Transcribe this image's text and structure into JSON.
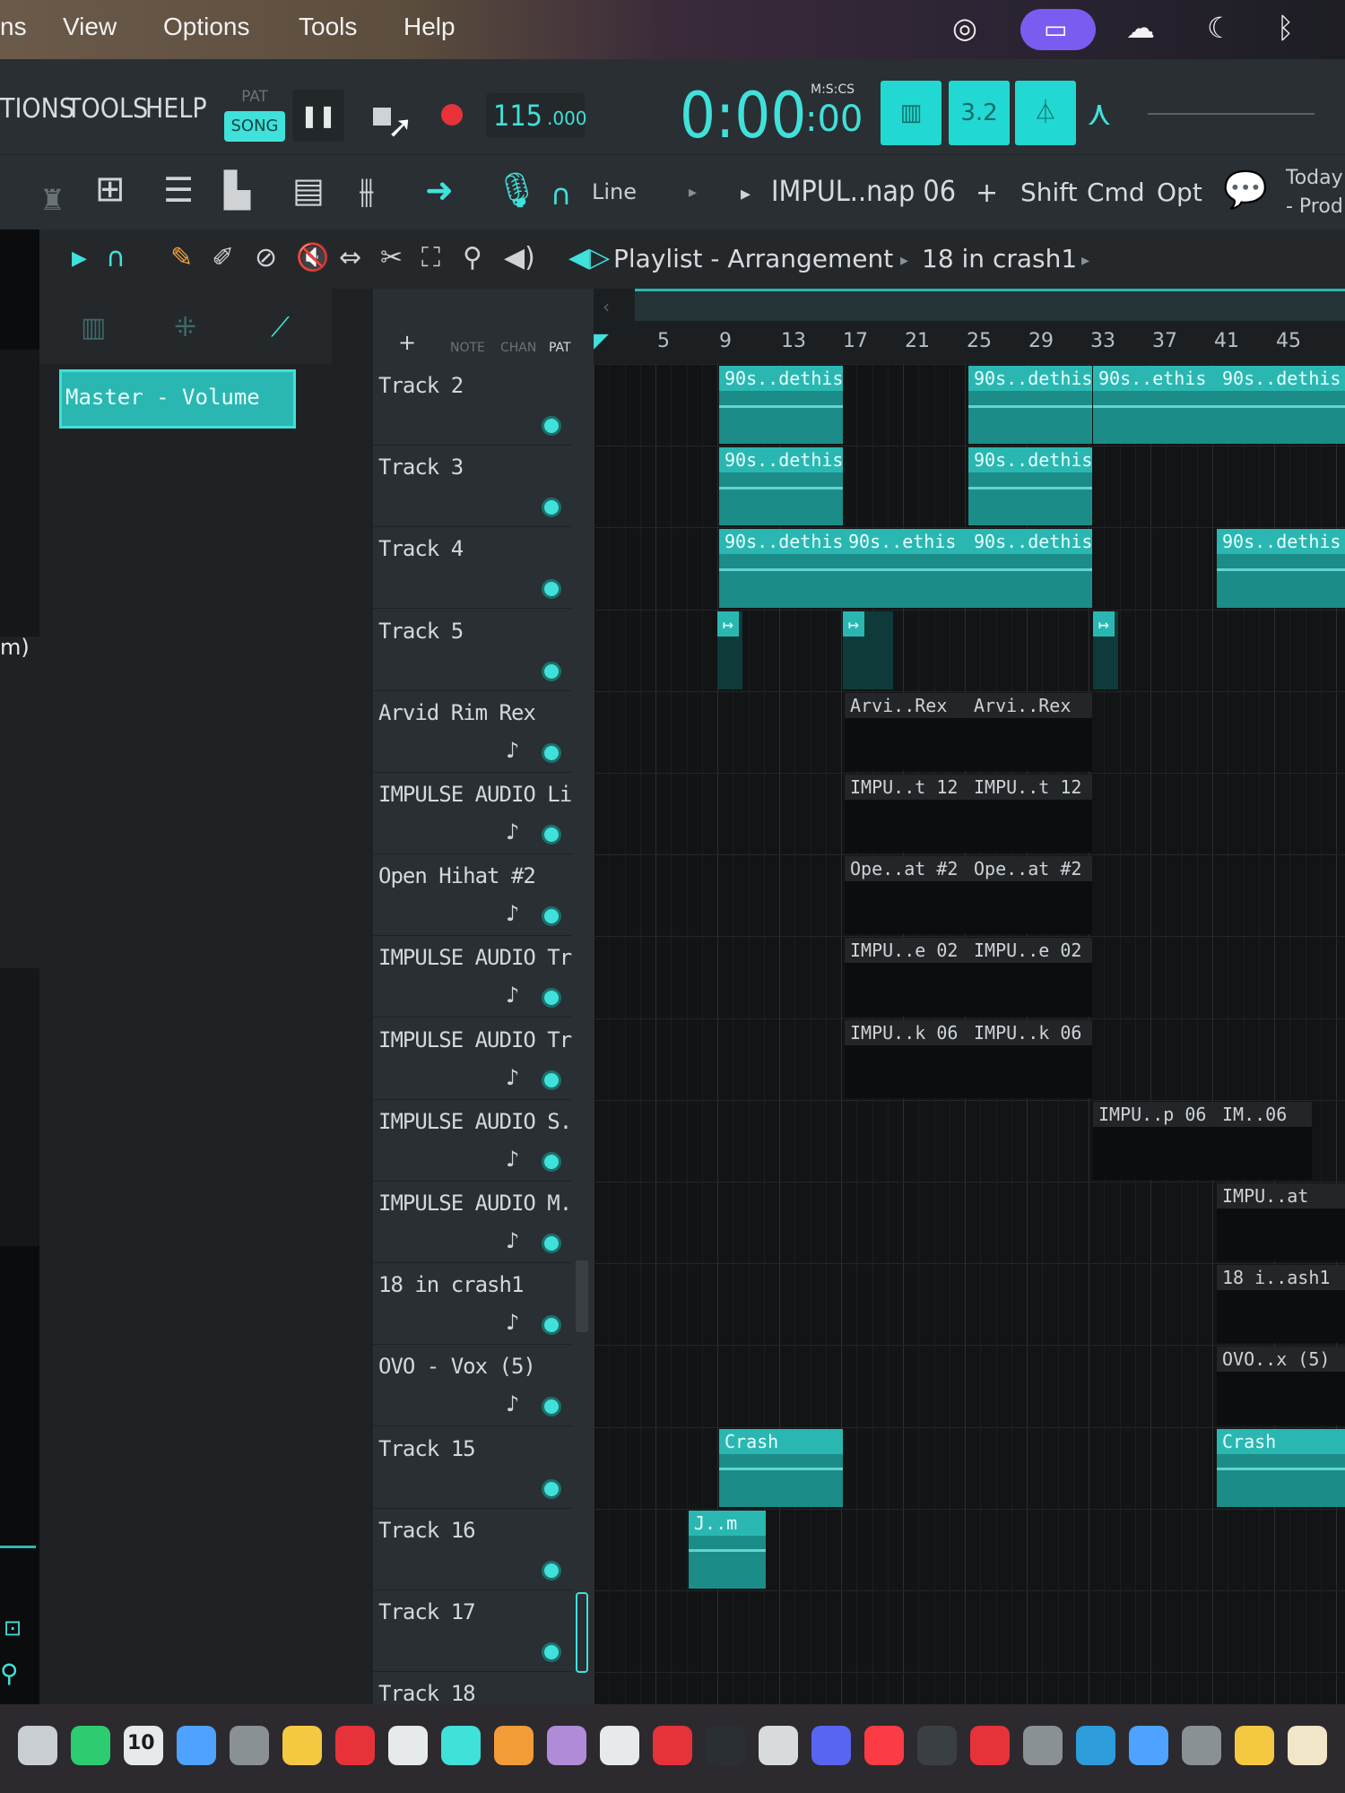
{
  "macmenu": {
    "items": [
      "ns",
      "View",
      "Options",
      "Tools",
      "Help"
    ]
  },
  "fl_menu": {
    "items": [
      "TIONS",
      "TOOLS",
      "HELP"
    ]
  },
  "transport": {
    "pat_label": "PAT",
    "song_label": "SONG",
    "tempo": "115",
    "tempo_dec": ".000",
    "time": "0:00",
    "time_small": ":00",
    "time_units": "M:S:CS",
    "tempo_btn": "3.2"
  },
  "toolbar2": {
    "line_mode": "Line",
    "pattern": "IMPUL..nap 06",
    "plus": "+",
    "shift": "Shift",
    "cmd": "Cmd",
    "opt": "Opt",
    "news_line1": "Today",
    "news_line2": "- Prod"
  },
  "playlist": {
    "title": "Playlist - Arrangement",
    "current_clip": "18 in crash1",
    "mini_labels": [
      "NOTE",
      "CHAN",
      "PAT"
    ],
    "add_label": "+"
  },
  "browser": {
    "selected": "Master - Volume",
    "left_text": "m)"
  },
  "ruler": {
    "bars": [
      "5",
      "9",
      "13",
      "17",
      "21",
      "25",
      "29",
      "33",
      "37",
      "41",
      "45"
    ]
  },
  "tracks": [
    {
      "name": "Track 2",
      "note": false
    },
    {
      "name": "Track 3",
      "note": false
    },
    {
      "name": "Track 4",
      "note": false
    },
    {
      "name": "Track 5",
      "note": false
    },
    {
      "name": "Arvid Rim Rex",
      "note": true
    },
    {
      "name": "IMPULSE AUDIO Li..",
      "note": true
    },
    {
      "name": "Open Hihat #2",
      "note": true
    },
    {
      "name": "IMPULSE AUDIO Tr..",
      "note": true
    },
    {
      "name": "IMPULSE AUDIO Tr..",
      "note": true
    },
    {
      "name": "IMPULSE AUDIO S..",
      "note": true
    },
    {
      "name": "IMPULSE AUDIO M..",
      "note": true
    },
    {
      "name": "18 in crash1",
      "note": true
    },
    {
      "name": "OVO - Vox (5)",
      "note": true
    },
    {
      "name": "Track 15",
      "note": false
    },
    {
      "name": "Track 16",
      "note": false
    },
    {
      "name": "Track 17",
      "note": false
    },
    {
      "name": "Track 18",
      "note": false
    }
  ],
  "clips": {
    "audio": [
      {
        "track": 0,
        "label": "90s..dethis"
      },
      {
        "track": 0,
        "label": "90s..dethis"
      },
      {
        "track": 0,
        "label": "90s..ethis"
      },
      {
        "track": 0,
        "label": "90s..dethis"
      },
      {
        "track": 1,
        "label": "90s..dethis"
      },
      {
        "track": 1,
        "label": "90s..dethis"
      },
      {
        "track": 2,
        "label": "90s..dethis"
      },
      {
        "track": 2,
        "label": "90s..ethis"
      },
      {
        "track": 2,
        "label": "90s..dethis"
      },
      {
        "track": 2,
        "label": "90s..dethis"
      },
      {
        "track": 13,
        "label": "Crash"
      },
      {
        "track": 13,
        "label": "Crash"
      },
      {
        "track": 14,
        "label": "J..m"
      }
    ],
    "pattern": [
      {
        "track": 4,
        "label": "Arvi..Rex"
      },
      {
        "track": 4,
        "label": "Arvi..Rex"
      },
      {
        "track": 5,
        "label": "IMPU..t 12"
      },
      {
        "track": 5,
        "label": "IMPU..t 12"
      },
      {
        "track": 6,
        "label": "Ope..at #2"
      },
      {
        "track": 6,
        "label": "Ope..at #2"
      },
      {
        "track": 7,
        "label": "IMPU..e 02"
      },
      {
        "track": 7,
        "label": "IMPU..e 02"
      },
      {
        "track": 8,
        "label": "IMPU..k 06"
      },
      {
        "track": 8,
        "label": "IMPU..k 06"
      },
      {
        "track": 9,
        "label": "IMPU..p 06"
      },
      {
        "track": 9,
        "label": "IM..06"
      },
      {
        "track": 10,
        "label": "IMPU..at"
      },
      {
        "track": 11,
        "label": "18 i..ash1"
      },
      {
        "track": 12,
        "label": "OVO..x (5)"
      }
    ]
  },
  "dock": {
    "badge_text": "10"
  },
  "colors": {
    "accent": "#2ab7b2",
    "accent_bright": "#3fe1da",
    "record": "#e8323a",
    "mac_pill": "#7a5cf0"
  }
}
